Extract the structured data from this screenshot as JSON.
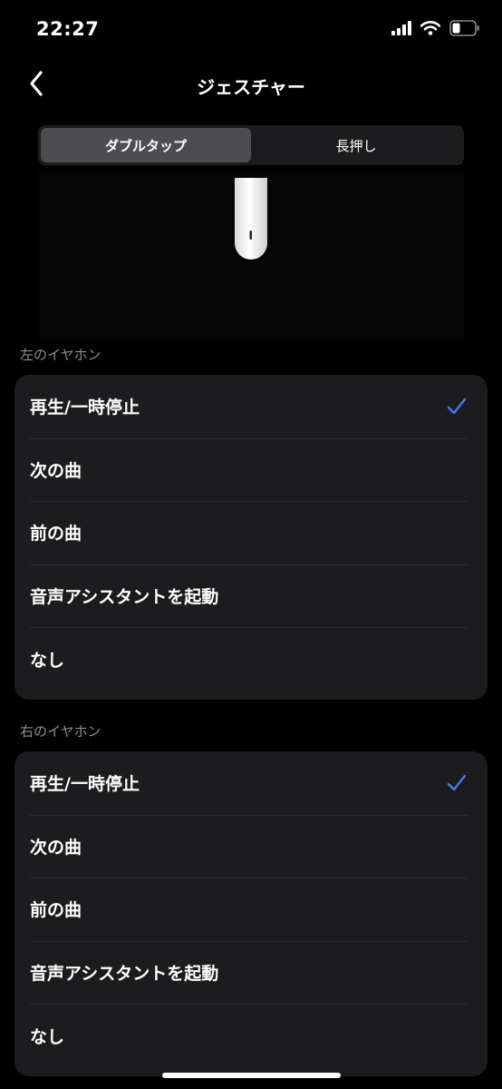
{
  "status_bar": {
    "time": "22:27",
    "icons": [
      "cellular-signal-icon",
      "wifi-icon",
      "battery-icon"
    ],
    "battery_level": 0.35
  },
  "header": {
    "back_icon": "chevron-left-icon",
    "title": "ジェスチャー"
  },
  "tabs": [
    {
      "label": "ダブルタップ",
      "selected": true
    },
    {
      "label": "長押し",
      "selected": false
    }
  ],
  "image": {
    "icon": "earbud-icon"
  },
  "left_earbud": {
    "section_label": "左のイヤホン",
    "options": [
      {
        "label": "再生/一時停止",
        "selected": true
      },
      {
        "label": "次の曲",
        "selected": false
      },
      {
        "label": "前の曲",
        "selected": false
      },
      {
        "label": "音声アシスタントを起動",
        "selected": false
      },
      {
        "label": "なし",
        "selected": false
      }
    ]
  },
  "right_earbud": {
    "section_label": "右のイヤホン",
    "options": [
      {
        "label": "再生/一時停止",
        "selected": true
      },
      {
        "label": "次の曲",
        "selected": false
      },
      {
        "label": "前の曲",
        "selected": false
      },
      {
        "label": "音声アシスタントを起動",
        "selected": false
      },
      {
        "label": "なし",
        "selected": false
      }
    ]
  },
  "colors": {
    "background": "#000000",
    "card": "#1c1c1e",
    "segment_active": "#4d4d51",
    "accent_check": "#3d7cf7",
    "secondary_text": "#8e8e93"
  }
}
